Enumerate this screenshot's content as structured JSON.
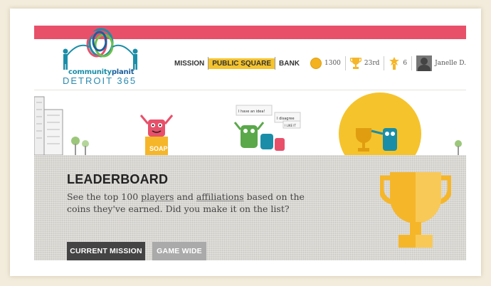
{
  "logo": {
    "word_part1": "community",
    "word_part2": "planit",
    "city": "DETROIT 365"
  },
  "nav": {
    "items": [
      {
        "label": "MISSION",
        "active": false
      },
      {
        "label": "PUBLIC SQUARE",
        "active": true
      },
      {
        "label": "BANK",
        "active": false
      }
    ]
  },
  "stats": {
    "coins": "1300",
    "rank": "23rd",
    "badges": "6",
    "user_name": "Janelle D."
  },
  "hero": {
    "bubbles": [
      "I have an idea!",
      "I disagree",
      "I LIKE IT"
    ],
    "soap_label": "SOAP"
  },
  "leaderboard": {
    "title": "LEADERBOARD",
    "desc_before": "See the top 100 ",
    "desc_link1": "players",
    "desc_middle": " and ",
    "desc_link2": "affiliations",
    "desc_after": " based on the coins they've earned. Did you make it on the list?",
    "btn_current": "CURRENT MISSION",
    "btn_wide": "GAME WIDE"
  },
  "colors": {
    "accent_bar": "#e8506a",
    "active_nav": "#f5c32c",
    "trophy": "#f5b62a"
  }
}
